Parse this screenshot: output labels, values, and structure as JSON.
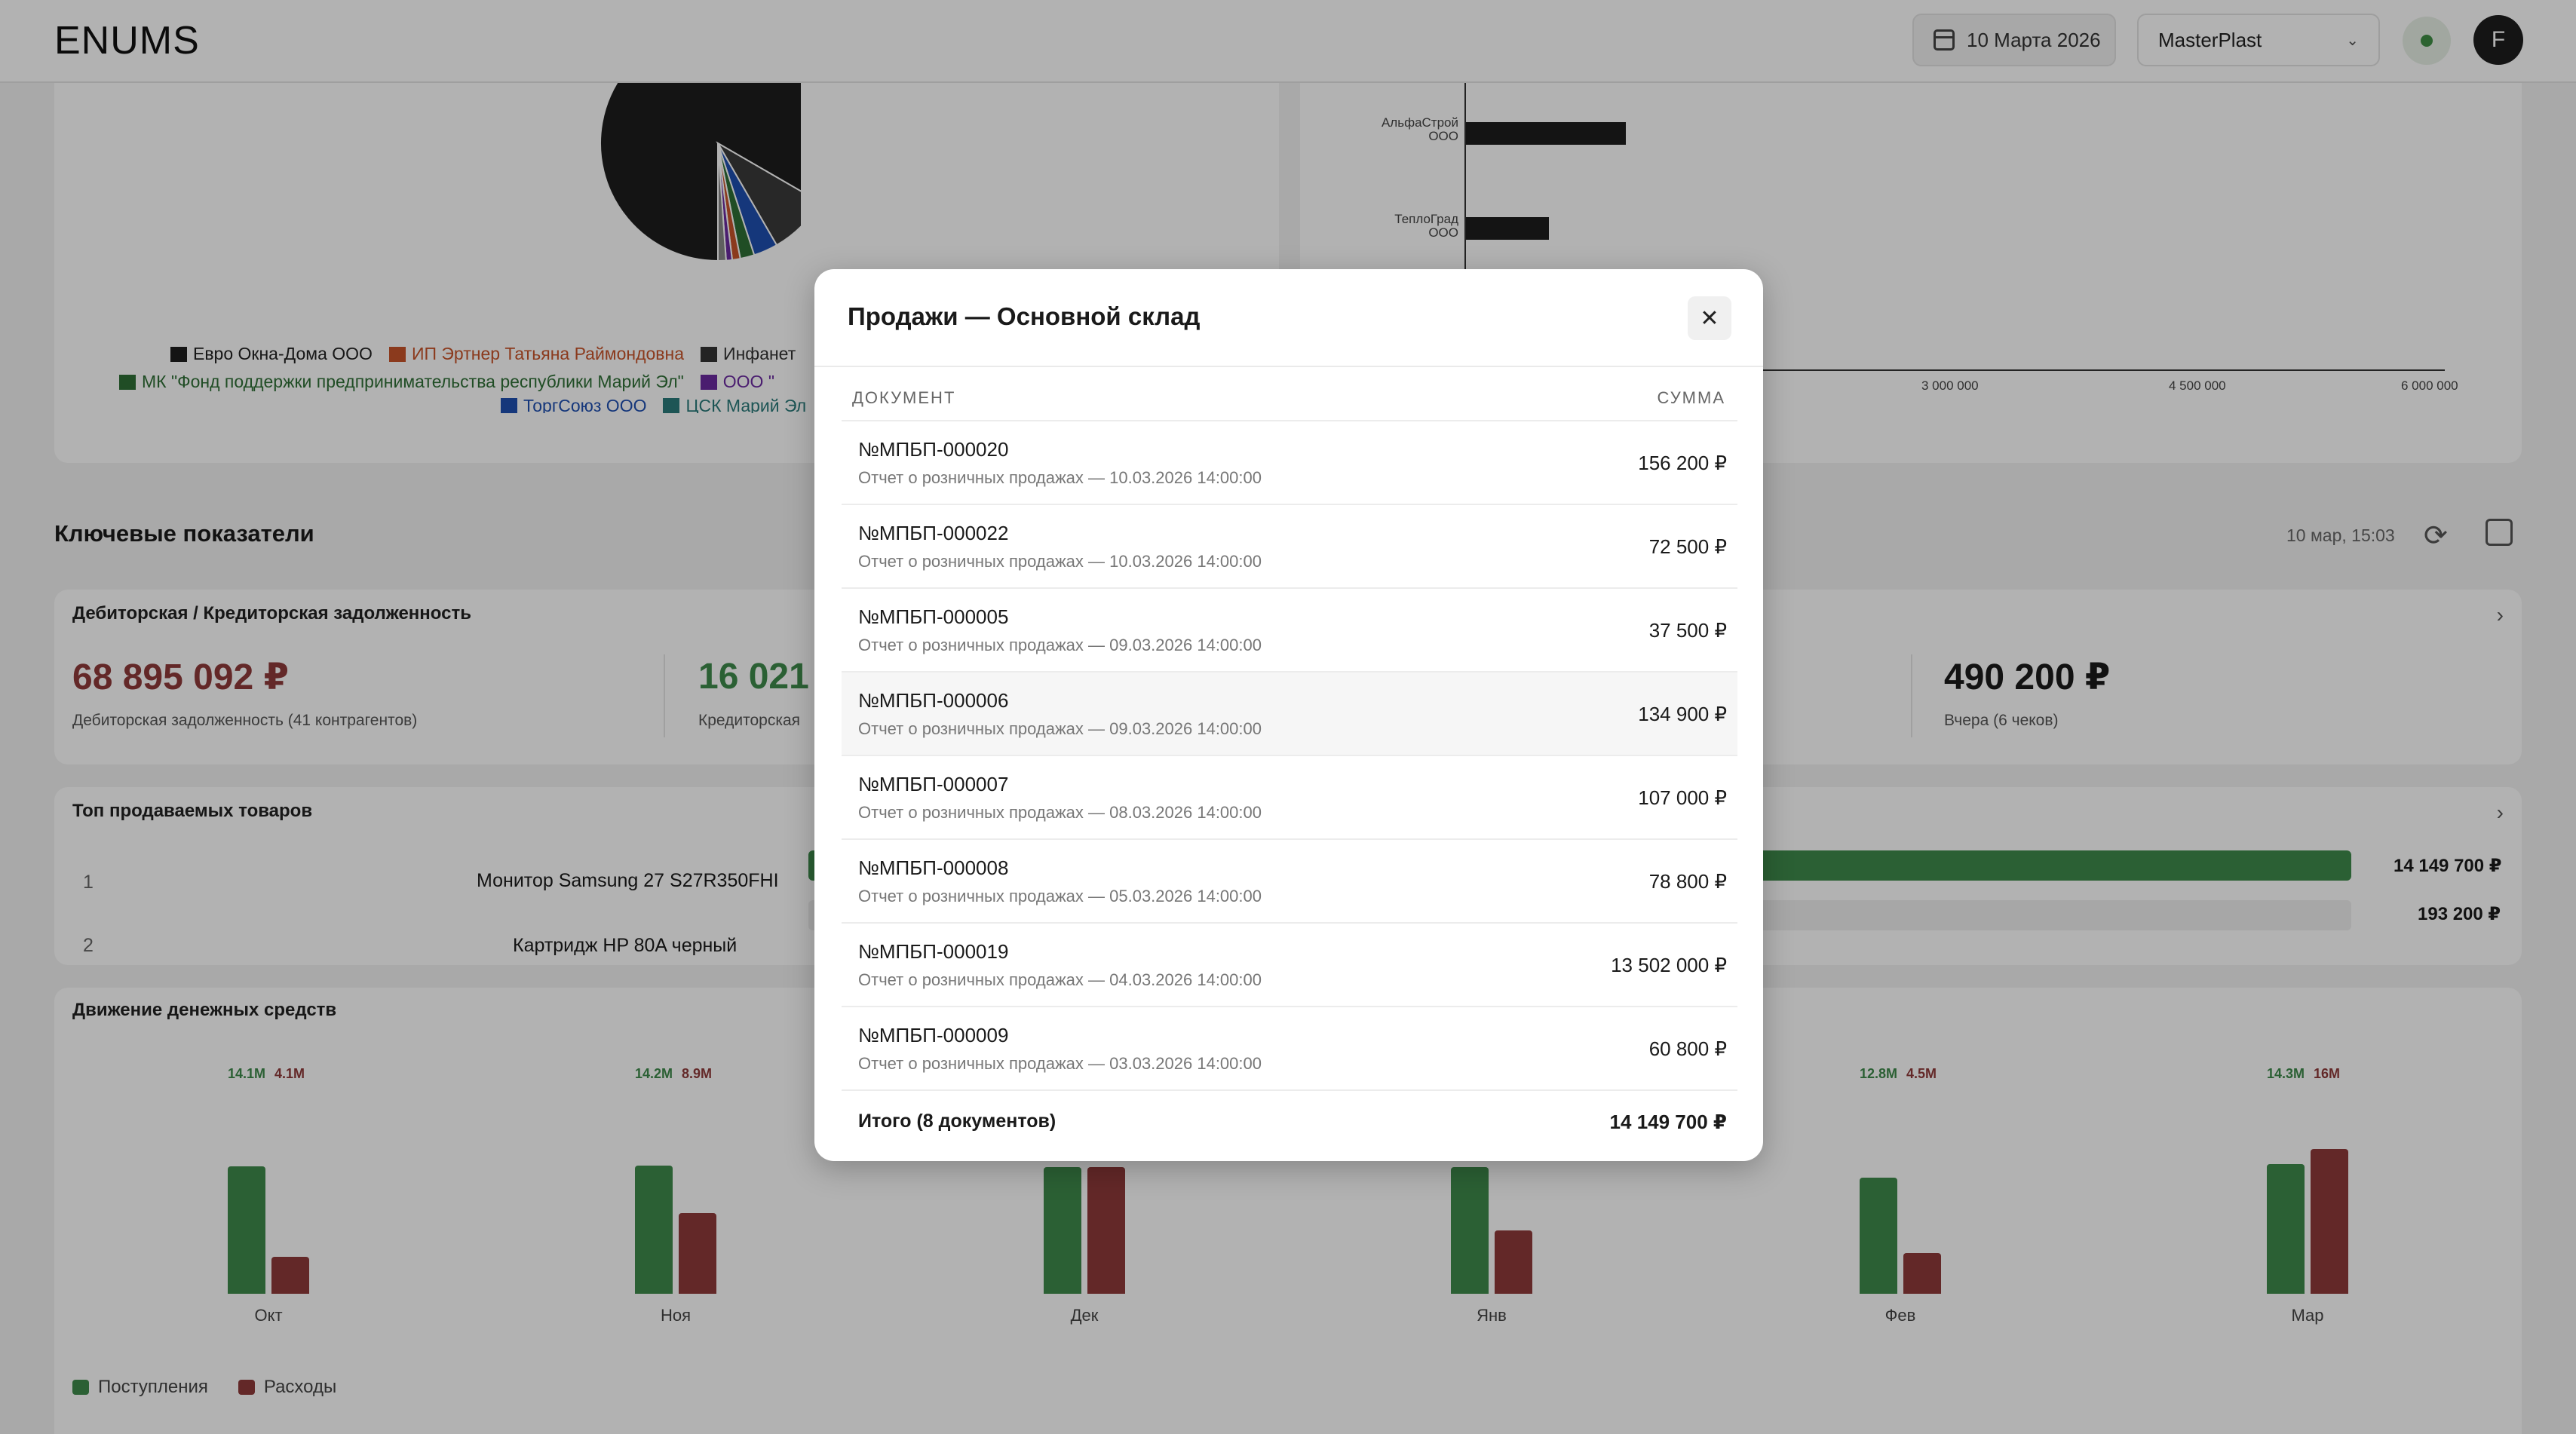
{
  "header": {
    "logo": "ENUMS",
    "date": "10 Марта 2026",
    "company": "MasterPlast",
    "avatar_initial": "F"
  },
  "pie_legend": {
    "row1": [
      "Евро Окна-Дома ООО",
      "ИП Эртнер Татьяна Раймондовна",
      "Инфанет"
    ],
    "row2": [
      "МК \"Фонд поддержки предпринимательства республики Марий Эл\"",
      "ООО \""
    ],
    "row3": [
      "ТоргСоюз ООО",
      "ЦСК Марий Эл"
    ]
  },
  "hbar_chart": {
    "labels": [
      [
        "АльфаСтрой",
        "ООО"
      ],
      [
        "ТеплоГрад",
        "ООО"
      ]
    ],
    "ticks": [
      "3 000 000",
      "4 500 000",
      "6 000 000"
    ]
  },
  "kpi": {
    "title": "Ключевые показатели",
    "updated": "10 мар, 15:03"
  },
  "debt": {
    "title": "Дебиторская / Кредиторская задолженность",
    "receivable_value": "68 895 092 ₽",
    "receivable_label": "Дебиторская задолженность (41 контрагентов)",
    "payable_value": "16 021",
    "payable_label": "Кредиторская",
    "yesterday_value": "490 200 ₽",
    "yesterday_label": "Вчера (6 чеков)"
  },
  "top_products": {
    "title": "Топ продаваемых товаров",
    "items": [
      {
        "rank": "1",
        "name": "Монитор Samsung 27 S27R350FHI",
        "value": "14 149 700 ₽"
      },
      {
        "rank": "2",
        "name": "Картридж HP 80A черный",
        "value": "193 200 ₽"
      }
    ]
  },
  "cashflow": {
    "title": "Движение денежных средств",
    "legend_in": "Поступления",
    "legend_out": "Расходы",
    "months": [
      {
        "label": "Окт",
        "in_label": "14.1M",
        "out_label": "4.1M",
        "in": 14.1,
        "out": 4.1
      },
      {
        "label": "Ноя",
        "in_label": "14.2M",
        "out_label": "8.9M",
        "in": 14.2,
        "out": 8.9
      },
      {
        "label": "Дек",
        "in_label": "",
        "out_label": "",
        "in": 14.0,
        "out": 14.0
      },
      {
        "label": "Янв",
        "in_label": "",
        "out_label": "",
        "in": 14.0,
        "out": 7.0
      },
      {
        "label": "Фев",
        "in_label": "12.8M",
        "out_label": "4.5M",
        "in": 12.8,
        "out": 4.5
      },
      {
        "label": "Мар",
        "in_label": "14.3M",
        "out_label": "16M",
        "in": 14.3,
        "out": 16
      }
    ]
  },
  "modal": {
    "title": "Продажи — Основной склад",
    "col_doc": "ДОКУМЕНТ",
    "col_sum": "СУММА",
    "rows": [
      {
        "num": "№МПБП-000020",
        "desc": "Отчет о розничных продажах — 10.03.2026 14:00:00",
        "sum": "156 200 ₽"
      },
      {
        "num": "№МПБП-000022",
        "desc": "Отчет о розничных продажах — 10.03.2026 14:00:00",
        "sum": "72 500 ₽"
      },
      {
        "num": "№МПБП-000005",
        "desc": "Отчет о розничных продажах — 09.03.2026 14:00:00",
        "sum": "37 500 ₽"
      },
      {
        "num": "№МПБП-000006",
        "desc": "Отчет о розничных продажах — 09.03.2026 14:00:00",
        "sum": "134 900 ₽"
      },
      {
        "num": "№МПБП-000007",
        "desc": "Отчет о розничных продажах — 08.03.2026 14:00:00",
        "sum": "107 000 ₽"
      },
      {
        "num": "№МПБП-000008",
        "desc": "Отчет о розничных продажах — 05.03.2026 14:00:00",
        "sum": "78 800 ₽"
      },
      {
        "num": "№МПБП-000019",
        "desc": "Отчет о розничных продажах — 04.03.2026 14:00:00",
        "sum": "13 502 000 ₽"
      },
      {
        "num": "№МПБП-000009",
        "desc": "Отчет о розничных продажах — 03.03.2026 14:00:00",
        "sum": "60 800 ₽"
      }
    ],
    "total_label": "Итого (8 документов)",
    "total_sum": "14 149 700 ₽"
  },
  "colors": {
    "income": "#3e8a4b",
    "expense": "#8f3a3a",
    "pie_main": "#1e1e1e",
    "pie_second": "#3a3a3a"
  }
}
